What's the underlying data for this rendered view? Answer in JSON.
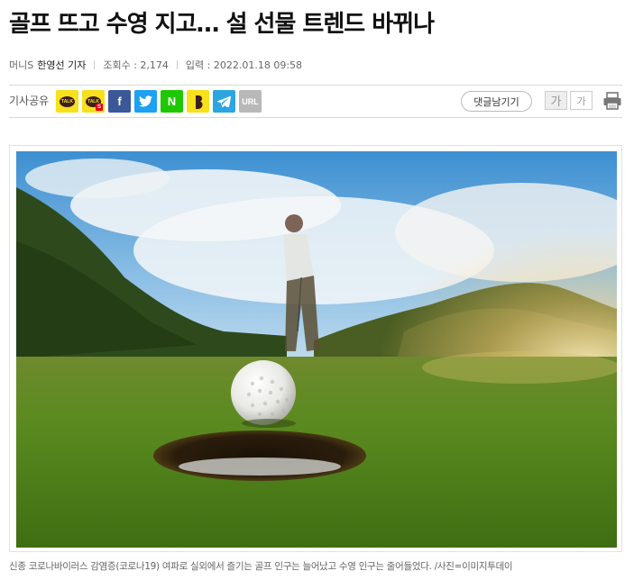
{
  "article": {
    "headline": "골프 뜨고 수영 지고… 설 선물 트렌드 바뀌나",
    "byline": {
      "source": "머니S",
      "reporter": "한영선 기자",
      "views_label": "조회수 : ",
      "views": "2,174",
      "date_label": "입력 : ",
      "date": "2022.01.18 09:58"
    },
    "share": {
      "label": "기사공유",
      "icons": [
        "kakaotalk-icon",
        "kakaostory-icon",
        "facebook-icon",
        "twitter-icon",
        "naver-icon",
        "band-icon",
        "telegram-icon",
        "url-copy-icon"
      ],
      "facebook_glyph": "f",
      "naver_glyph": "N",
      "url_label": "URL"
    },
    "tools": {
      "comment_label": "댓글남기기",
      "font_large": "가",
      "font_small": "가"
    },
    "photo": {
      "subject": "golf ball on green near hole with golfer in background",
      "caption": "신종 코로나바이러스 감염증(코로나19) 여파로 실외에서 즐기는 골프 인구는 늘어났고 수영 인구는 줄어들었다. /사진=이미지투데이"
    }
  },
  "colors": {
    "kakao_yellow": "#f7e01c",
    "facebook_blue": "#3b5998",
    "twitter_blue": "#1da1f2",
    "naver_green": "#1ec800",
    "telegram_blue": "#2ca5e0",
    "url_gray": "#b8b8b8"
  }
}
